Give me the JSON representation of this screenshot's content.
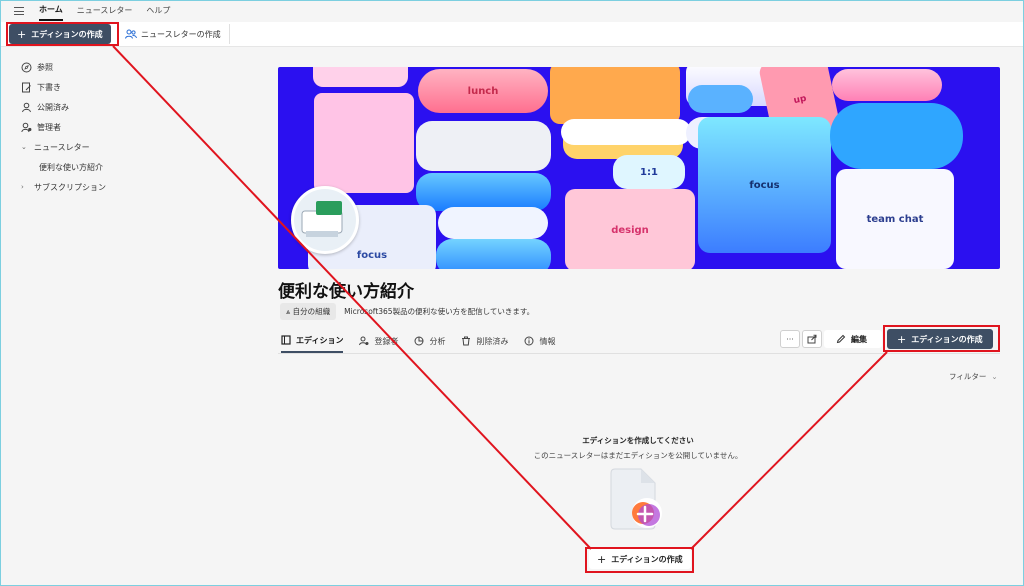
{
  "topbar": {
    "nav": [
      "ホーム",
      "ニュースレター",
      "ヘルプ"
    ]
  },
  "commandbar": {
    "create_edition": "エディションの作成",
    "create_newsletter": "ニュースレターの作成"
  },
  "sidebar": {
    "items": [
      {
        "label": "参照",
        "icon": "compass-icon"
      },
      {
        "label": "下書き",
        "icon": "draft-icon"
      },
      {
        "label": "公開済み",
        "icon": "person-icon"
      },
      {
        "label": "管理者",
        "icon": "admin-icon"
      },
      {
        "label": "ニュースレター",
        "icon": "chevron-down-icon"
      },
      {
        "label": "便利な使い方紹介",
        "icon": ""
      },
      {
        "label": "サブスクリプション",
        "icon": "chevron-right-icon"
      }
    ]
  },
  "banner": {
    "labels": [
      "lunch",
      "focus",
      "1:1",
      "design",
      "focus",
      "team chat",
      "up"
    ]
  },
  "newsletter": {
    "title": "便利な使い方紹介",
    "org": "自分の組織",
    "description": "Microsoft365製品の便利な使い方を配信していきます。"
  },
  "tabs": [
    "エディション",
    "登録者",
    "分析",
    "削除済み",
    "情報"
  ],
  "toolbar": {
    "more": "···",
    "edit": "編集",
    "create_edition": "エディションの作成"
  },
  "filter": {
    "label": "フィルター"
  },
  "empty": {
    "title": "エディションを作成してください",
    "subtitle": "このニュースレターはまだエディションを公開していません。",
    "create": "エディションの作成"
  },
  "colors": {
    "primary": "#3e4e64",
    "highlight": "#e0141e",
    "banner_bg": "#2b10f0"
  }
}
